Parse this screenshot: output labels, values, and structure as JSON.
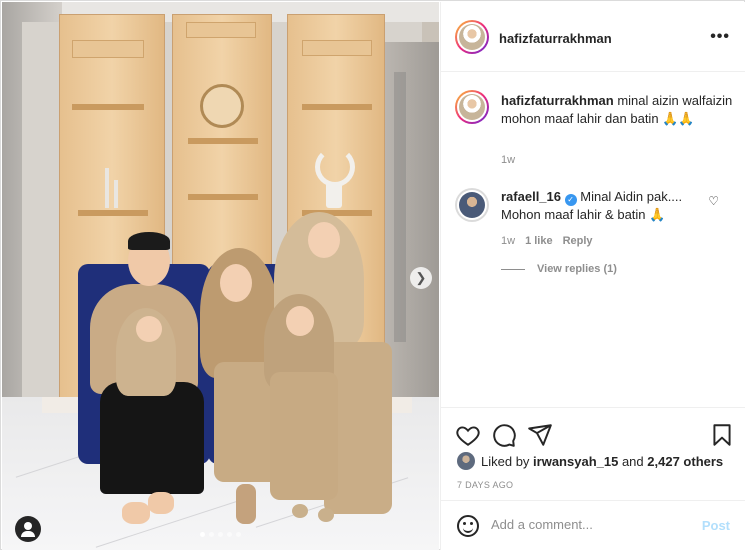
{
  "post": {
    "author": "hafizfaturrakhman",
    "more_icon": "more-horizontal-icon",
    "caption": {
      "username": "hafizfaturrakhman",
      "text": "minal aizin walfaizin mohon maaf lahir dan batin 🙏🙏",
      "time": "1w"
    },
    "comments": [
      {
        "username": "rafaell_16",
        "verified": true,
        "text_line1": "Minal Aidin pak....",
        "text_line2": "Mohon maaf lahir & batin 🙏",
        "time": "1w",
        "likes": "1 like",
        "reply_label": "Reply",
        "view_replies": "View replies (1)"
      }
    ],
    "liked_by_prefix": "Liked by",
    "liked_by_user": "irwansyah_15",
    "liked_by_and": "and",
    "liked_by_others": "2,427 others",
    "date": "7 DAYS AGO",
    "comment_placeholder": "Add a comment...",
    "post_button": "Post",
    "carousel": {
      "total": 5,
      "active_index": 0
    },
    "colors": {
      "verified": "#3897f0",
      "post_disabled": "#b2dffc",
      "text": "#262626",
      "meta": "#8e8e8e"
    }
  }
}
